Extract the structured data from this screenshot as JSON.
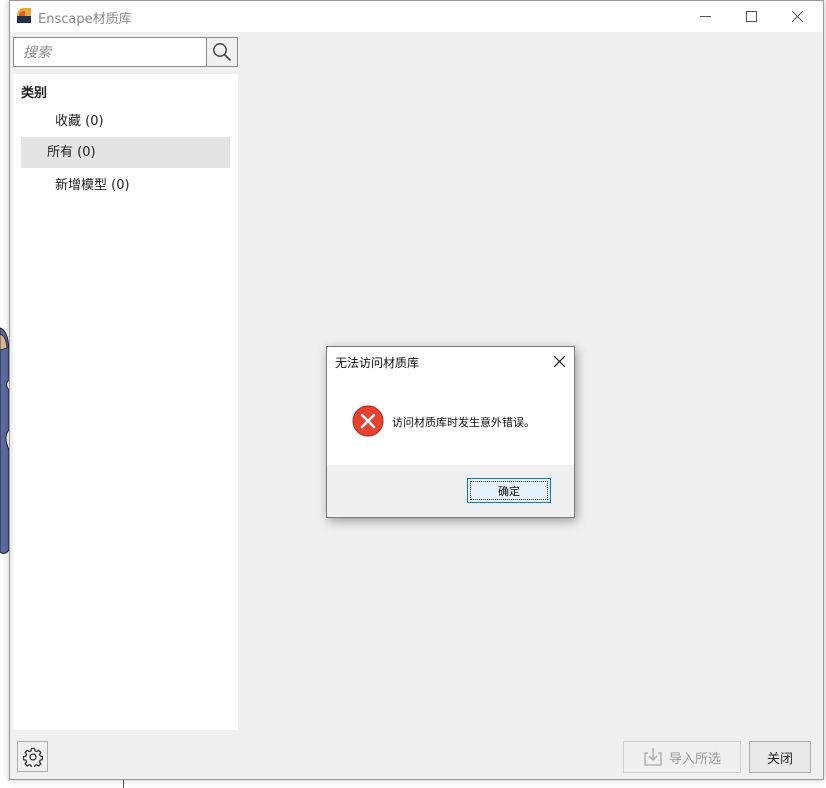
{
  "window": {
    "title": "Enscape材质库"
  },
  "search": {
    "placeholder": "搜索",
    "value": ""
  },
  "sidebar": {
    "heading": "类别",
    "items": [
      {
        "label": "收藏 (0)",
        "selected": false
      },
      {
        "label": "所有 (0)",
        "selected": true
      },
      {
        "label": "新增模型 (0)",
        "selected": false
      }
    ]
  },
  "footer": {
    "import_label": "导入所选",
    "close_label": "关闭"
  },
  "dialog": {
    "title": "无法访问材质库",
    "message": "访问材质库时发生意外错误。",
    "ok_label": "确定"
  },
  "colors": {
    "error_red": "#e8412f",
    "accent_blue": "#0078d7",
    "selected_bg": "#e4e4e4"
  }
}
